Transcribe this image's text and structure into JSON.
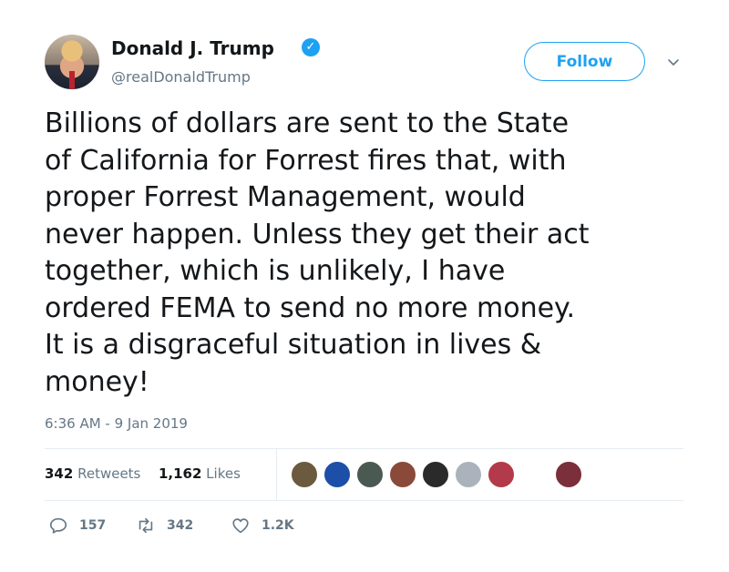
{
  "author": {
    "name": "Donald J. Trump",
    "handle": "@realDonaldTrump",
    "verified_mark": "✓"
  },
  "follow_label": "Follow",
  "tweet_text": "Billions of dollars are sent to the State\nof California for Forrest fires that, with\nproper Forrest Management, would\nnever happen. Unless they get their act\ntogether, which is unlikely, I have\nordered FEMA to send no more money.\nIt is a disgraceful situation in lives &\nmoney!",
  "timestamp": "6:36 AM - 9 Jan 2019",
  "stats": {
    "retweets_count": "342",
    "retweets_label": "Retweets",
    "likes_count": "1,162",
    "likes_label": "Likes"
  },
  "actions": {
    "replies": "157",
    "retweets": "342",
    "likes": "1.2K"
  },
  "liker_avatars": [
    {
      "color": "#6b5a3e"
    },
    {
      "color": "#1d4fa8"
    },
    {
      "color": "#4a5a52"
    },
    {
      "color": "#8a4a3a"
    },
    {
      "color": "#2a2a2a"
    },
    {
      "color": "#aab3bb"
    },
    {
      "color": "#b33a4a"
    },
    {
      "color": "#7a2f3a"
    }
  ],
  "colors": {
    "accent": "#1da1f2",
    "muted": "#657786",
    "text": "#14171a"
  }
}
